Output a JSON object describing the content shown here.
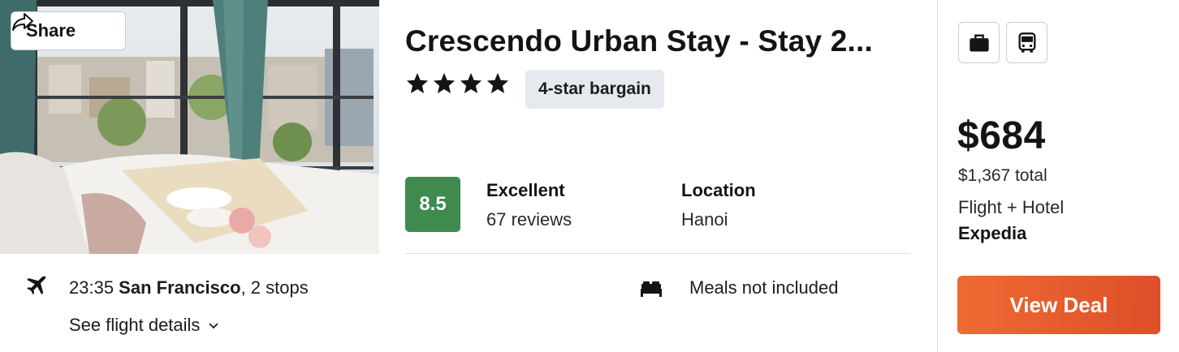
{
  "share": {
    "label": "Share"
  },
  "hotel": {
    "name": "Crescendo Urban Stay - Stay 2...",
    "star_count": 4,
    "badge": "4-star bargain"
  },
  "rating": {
    "score": "8.5",
    "label": "Excellent",
    "reviews": "67 reviews",
    "score_color": "#3f8a4f"
  },
  "location": {
    "label": "Location",
    "value": "Hanoi"
  },
  "flight": {
    "time": "23:35",
    "city": "San Francisco",
    "stops": ", 2 stops",
    "details_link": "See flight details"
  },
  "meals": {
    "label": "Meals not included"
  },
  "amenities": [
    {
      "icon": "briefcase-icon"
    },
    {
      "icon": "bus-icon"
    }
  ],
  "pricing": {
    "price": "$684",
    "total": "$1,367 total",
    "package": "Flight + Hotel",
    "provider": "Expedia"
  },
  "cta": {
    "label": "View Deal",
    "color": "#e55c2d"
  }
}
